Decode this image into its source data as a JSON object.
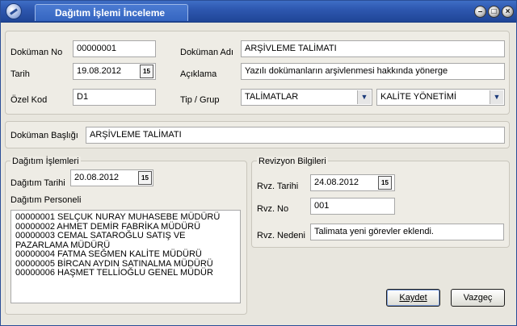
{
  "window": {
    "title": "Dağıtım İşlemi İnceleme"
  },
  "header": {
    "doc_no_label": "Doküman No",
    "doc_no_value": "00000001",
    "doc_name_label": "Doküman Adı",
    "doc_name_value": "ARŞİVLEME TALİMATI",
    "date_label": "Tarih",
    "date_value": "19.08.2012",
    "description_label": "Açıklama",
    "description_value": "Yazılı dokümanların arşivlenmesi hakkında yönerge",
    "special_code_label": "Özel Kod",
    "special_code_value": "D1",
    "type_group_label": "Tip / Grup",
    "type_value": "TALİMATLAR",
    "group_value": "KALİTE YÖNETİMİ"
  },
  "title_section": {
    "label": "Doküman Başlığı",
    "value": "ARŞİVLEME TALİMATI"
  },
  "distribution": {
    "legend": "Dağıtım İşlemleri",
    "date_label": "Dağıtım Tarihi",
    "date_value": "20.08.2012",
    "personnel_label": "Dağıtım Personeli",
    "personnel": [
      "00000001 SELÇUK NURAY MUHASEBE MÜDÜRÜ",
      "00000002 AHMET DEMİR FABRİKA MÜDÜRÜ",
      "00000003 CEMAL SATAROĞLU SATIŞ VE PAZARLAMA MÜDÜRÜ",
      "00000004 FATMA SEĞMEN KALİTE MÜDÜRÜ",
      "00000005 BİRCAN AYDIN SATINALMA MÜDÜRÜ",
      "00000006 HAŞMET TELLİOĞLU GENEL MÜDÜR"
    ]
  },
  "revision": {
    "legend": "Revizyon Bilgileri",
    "date_label": "Rvz. Tarihi",
    "date_value": "24.08.2012",
    "no_label": "Rvz. No",
    "no_value": "001",
    "reason_label": "Rvz. Nedeni",
    "reason_value": "Talimata yeni görevler eklendi."
  },
  "buttons": {
    "save": "Kaydet",
    "cancel": "Vazgeç"
  },
  "icons": {
    "calendar": "15",
    "dropdown": "▼",
    "min": "–",
    "max": "□",
    "close": "×"
  }
}
